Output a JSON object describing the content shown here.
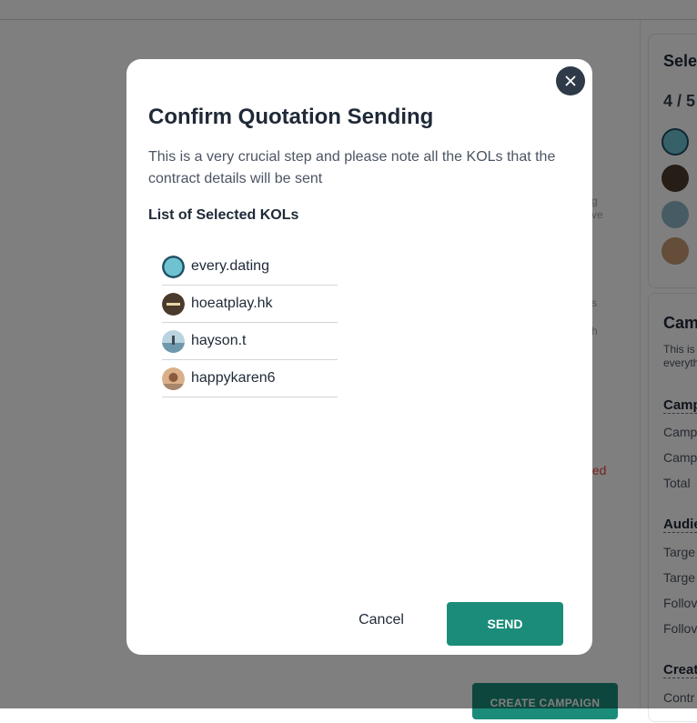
{
  "background": {
    "selected_title": "Sele",
    "selected_count": "4 / 5",
    "campaign_title": "Cam",
    "campaign_desc": "This is everyth",
    "sections": [
      "Camp",
      "Audie",
      "Creat"
    ],
    "rows": [
      "Camp",
      "Camp",
      "Total",
      "Targe",
      "Targe",
      "Follov",
      "Follov",
      "Contr"
    ],
    "frag_g": "g",
    "frag_ve": "ve",
    "frag_s": "s",
    "frag_h": "h",
    "cted_text": "cted",
    "create_button": "CREATE CAMPAIGN"
  },
  "modal": {
    "title": "Confirm Quotation Sending",
    "description": "This is a very crucial step and please note all the KOLs that the contract details will be sent",
    "list_title": "List of Selected KOLs",
    "kols": [
      {
        "name": "every.dating",
        "avatar_color": "#6fc3d0"
      },
      {
        "name": "hoeatplay.hk",
        "avatar_color": "#4a3a2c"
      },
      {
        "name": "hayson.t",
        "avatar_color": "#8fb6c8"
      },
      {
        "name": "happykaren6",
        "avatar_color": "#c99a73"
      }
    ],
    "cancel_label": "Cancel",
    "send_label": "SEND",
    "close_icon": "close-icon"
  },
  "colors": {
    "accent": "#1b8c79",
    "overlay": "rgba(0,0,0,0.5)",
    "close_bg": "#2f3a48"
  }
}
